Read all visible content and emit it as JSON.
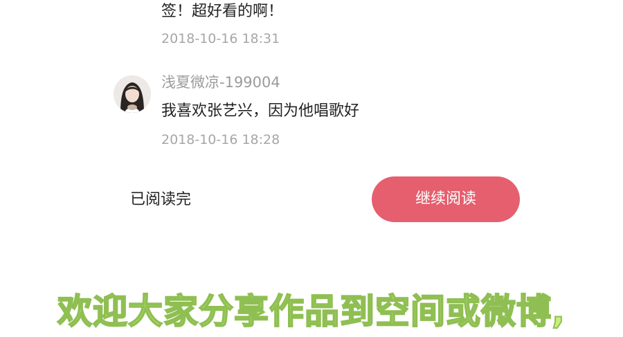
{
  "previous_comment": {
    "text_tail": "签！超好看的啊！",
    "time": "2018-10-16 18:31"
  },
  "comment": {
    "username": "浅夏微凉-199004",
    "text": "我喜欢张艺兴，因为他唱歌好",
    "time": "2018-10-16 18:28",
    "avatar_icon": "user-avatar-photo"
  },
  "footer": {
    "read_done_label": "已阅读完",
    "continue_label": "继续阅读",
    "continue_color": "#e55f6e"
  },
  "overlay_caption": "欢迎大家分享作品到空间或微博,"
}
